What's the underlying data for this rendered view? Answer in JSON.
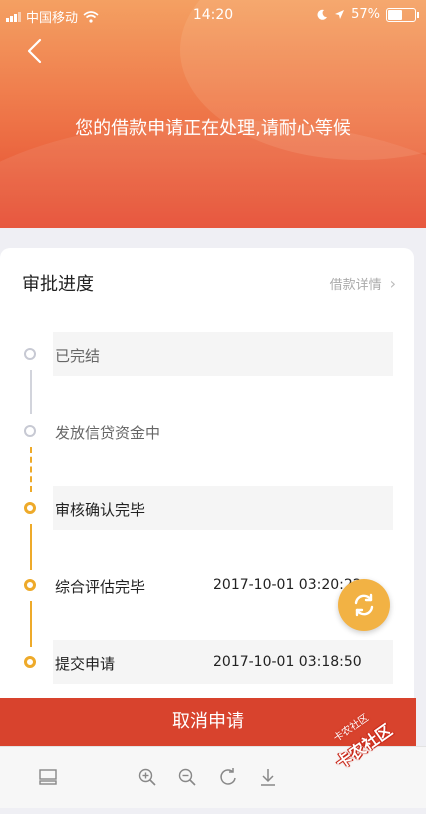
{
  "status_bar": {
    "carrier": "中国移动",
    "time": "14:20",
    "battery": "57%",
    "battery_level": 0.57
  },
  "hero": {
    "message": "您的借款申请正在处理,请耐心等候"
  },
  "card": {
    "title": "审批进度",
    "detail_link": "借款详情"
  },
  "steps": [
    {
      "label": "已完结",
      "time": "",
      "state": "pending"
    },
    {
      "label": "发放信贷资金中",
      "time": "",
      "state": "pending"
    },
    {
      "label": "审核确认完毕",
      "time": "",
      "state": "done"
    },
    {
      "label": "综合评估完毕",
      "time": "2017-10-01 03:20:22",
      "state": "done"
    },
    {
      "label": "提交申请",
      "time": "2017-10-01 03:18:50",
      "state": "done"
    }
  ],
  "cancel_button": "取消申请",
  "watermark": {
    "main": "卡农社区",
    "small": "卡农社区"
  },
  "colors": {
    "accent_gold": "#eeaa2a",
    "cancel_red": "#d8432d",
    "pending_gray": "#c7c9d3"
  }
}
